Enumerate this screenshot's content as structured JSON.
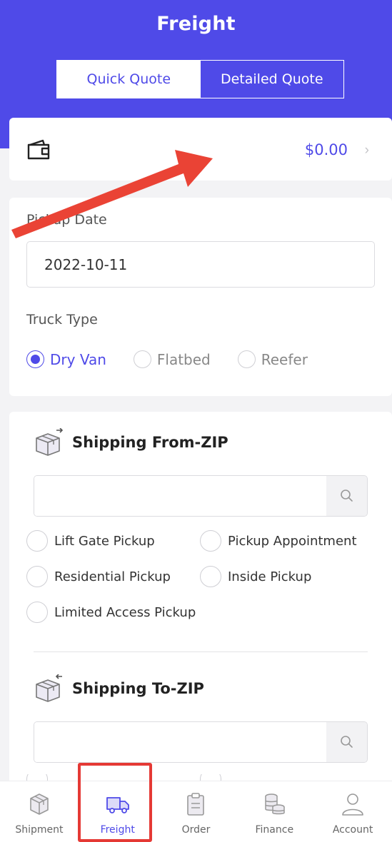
{
  "header": {
    "title": "Freight",
    "tabs": [
      {
        "label": "Quick Quote",
        "active": true
      },
      {
        "label": "Detailed Quote",
        "active": false
      }
    ]
  },
  "wallet": {
    "icon": "wallet-icon",
    "balance": "$0.00"
  },
  "pickup": {
    "date_label": "Pickup Date",
    "date_value": "2022-10-11",
    "truck_type_label": "Truck Type",
    "truck_types": [
      {
        "label": "Dry Van",
        "selected": true
      },
      {
        "label": "Flatbed",
        "selected": false
      },
      {
        "label": "Reefer",
        "selected": false
      }
    ]
  },
  "shipping_from": {
    "title": "Shipping From-ZIP",
    "zip_value": "",
    "options": [
      {
        "label": "Lift Gate Pickup",
        "checked": false
      },
      {
        "label": "Pickup Appointment",
        "checked": false
      },
      {
        "label": "Residential Pickup",
        "checked": false
      },
      {
        "label": "Inside Pickup",
        "checked": false
      },
      {
        "label": "Limited Access Pickup",
        "checked": false
      }
    ]
  },
  "shipping_to": {
    "title": "Shipping To-ZIP",
    "zip_value": ""
  },
  "nav": [
    {
      "label": "Shipment",
      "icon": "box-icon",
      "active": false
    },
    {
      "label": "Freight",
      "icon": "truck-icon",
      "active": true
    },
    {
      "label": "Order",
      "icon": "clipboard-icon",
      "active": false
    },
    {
      "label": "Finance",
      "icon": "coins-icon",
      "active": false
    },
    {
      "label": "Account",
      "icon": "user-icon",
      "active": false
    }
  ],
  "colors": {
    "primary": "#4f4ae8",
    "annotation": "#e53935"
  }
}
